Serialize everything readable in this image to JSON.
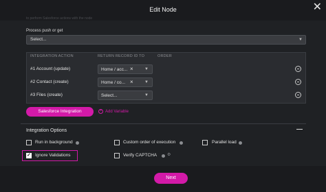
{
  "header": {
    "title": "Edit Node",
    "close_glyph": "✕",
    "faded_text": "to perform Salesforce actions with the node"
  },
  "process": {
    "label": "Process push or get",
    "value": "Select..."
  },
  "integration_table": {
    "headers": [
      "INTEGRATION ACTION",
      "RETURN RECORD ID TO",
      "ORDER"
    ],
    "rows": [
      {
        "action": "#1 Account (update)",
        "target": "Home / acc...",
        "clear": "×"
      },
      {
        "action": "#2 Contact (create)",
        "target": "Home / co...",
        "clear": "×"
      },
      {
        "action": "#3 Files (create)",
        "target": "Select...",
        "clear": ""
      }
    ]
  },
  "buttons": {
    "salesforce": "Salesforce Integration",
    "add_variable": "Add Variable",
    "next": "Next"
  },
  "options": {
    "title": "Integration Options",
    "items": [
      {
        "label": "Run in background",
        "checked": false
      },
      {
        "label": "Custom order of execution",
        "checked": false
      },
      {
        "label": "Parallel load",
        "checked": false
      },
      {
        "label": "Ignore Validations",
        "checked": true
      },
      {
        "label": "Verify CAPTCHA",
        "checked": false
      }
    ]
  },
  "colors": {
    "accent": "#d31aa8",
    "background": "#1f2124",
    "panel": "#2a2c30"
  }
}
